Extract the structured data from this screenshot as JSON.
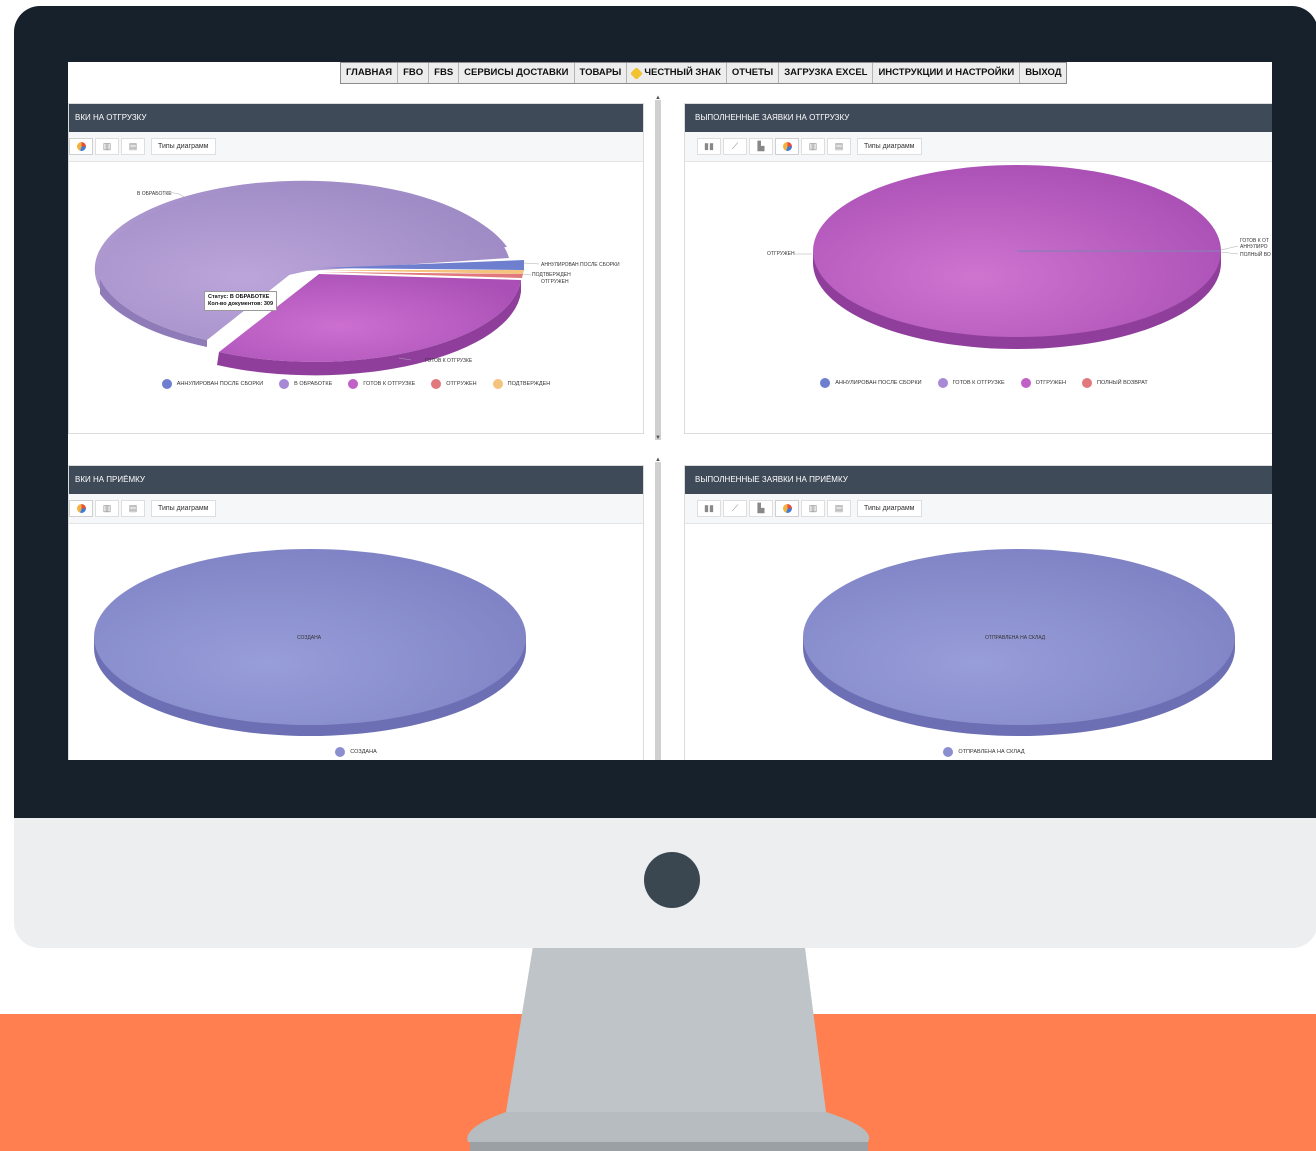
{
  "nav": {
    "items": [
      "ГЛАВНАЯ",
      "FBO",
      "FBS",
      "СЕРВИСЫ ДОСТАВКИ",
      "ТОВАРЫ",
      "ЧЕСТНЫЙ ЗНАК",
      "ОТЧЕТЫ",
      "ЗАГРУЗКА EXCEL",
      "ИНСТРУКЦИИ И НАСТРОЙКИ",
      "ВЫХОД"
    ]
  },
  "panels": {
    "shipment_requests": {
      "title": "ВКИ НА ОТГРУЗКУ",
      "types_label": "Типы диаграмм",
      "tooltip_status": "Статус: В ОБРАБОТКЕ",
      "tooltip_count": "Кол-во документов: 309",
      "labels": [
        "В ОБРАБОТКЕ",
        "АННУЛИРОВАН ПОСЛЕ СБОРКИ",
        "ПОДТВЕРЖДЕН",
        "ОТГРУЖЕН",
        "ГОТОВ К ОТГРУЗКЕ"
      ],
      "legend": [
        "АННУЛИРОВАН ПОСЛЕ СБОРКИ",
        "В ОБРАБОТКЕ",
        "ГОТОВ К ОТГРУЗКЕ",
        "ОТГРУЖЕН",
        "ПОДТВЕРЖДЕН"
      ]
    },
    "completed_shipment": {
      "title": "ВЫПОЛНЕННЫЕ ЗАЯВКИ НА ОТГРУЗКУ",
      "types_label": "Типы диаграмм",
      "labels": [
        "ОТГРУЖЕН",
        "ГОТОВ К ОТ",
        "АННУЛИРО",
        "ПОЛНЫЙ ВО"
      ],
      "legend": [
        "АННУЛИРОВАН ПОСЛЕ СБОРКИ",
        "ГОТОВ К ОТГРУЗКЕ",
        "ОТГРУЖЕН",
        "ПОЛНЫЙ ВОЗВРАТ"
      ]
    },
    "receipt_requests": {
      "title": "ВКИ НА ПРИЁМКУ",
      "types_label": "Типы диаграмм",
      "labels": [
        "СОЗДАНА"
      ],
      "legend": [
        "СОЗДАНА"
      ]
    },
    "completed_receipt": {
      "title": "ВЫПОЛНЕННЫЕ ЗАЯВКИ НА ПРИЁМКУ",
      "types_label": "Типы диаграмм",
      "labels": [
        "ОТПРАВЛЕНА НА СКЛАД"
      ],
      "legend": [
        "ОТПРАВЛЕНА НА СКЛАД"
      ]
    }
  },
  "colors": {
    "in_processing": "#b09acf",
    "ready": "#c061c8",
    "cancelled": "#6f7fcf",
    "shipped": "#e0787e",
    "confirmed": "#f4c37e",
    "created": "#8b8fd0",
    "header": "#3f4a59",
    "orange": "#ff7f50"
  },
  "chart_data": [
    {
      "type": "pie",
      "title": "",
      "categories": [
        "АННУЛИРОВАН ПОСЛЕ СБОРКИ",
        "В ОБРАБОТКЕ",
        "ГОТОВ К ОТГРУЗКЕ",
        "ОТГРУЖЕН",
        "ПОДТВЕРЖДЕН"
      ],
      "values": [
        3,
        309,
        180,
        2,
        1
      ]
    },
    {
      "type": "pie",
      "title": "",
      "categories": [
        "АННУЛИРОВАН ПОСЛЕ СБОРКИ",
        "ГОТОВ К ОТГРУЗКЕ",
        "ОТГРУЖЕН",
        "ПОЛНЫЙ ВОЗВРАТ"
      ],
      "values": [
        0.3,
        0.3,
        99.1,
        0.3
      ]
    },
    {
      "type": "pie",
      "title": "",
      "categories": [
        "СОЗДАНА"
      ],
      "values": [
        100
      ]
    },
    {
      "type": "pie",
      "title": "",
      "categories": [
        "ОТПРАВЛЕНА НА СКЛАД"
      ],
      "values": [
        100
      ]
    }
  ]
}
